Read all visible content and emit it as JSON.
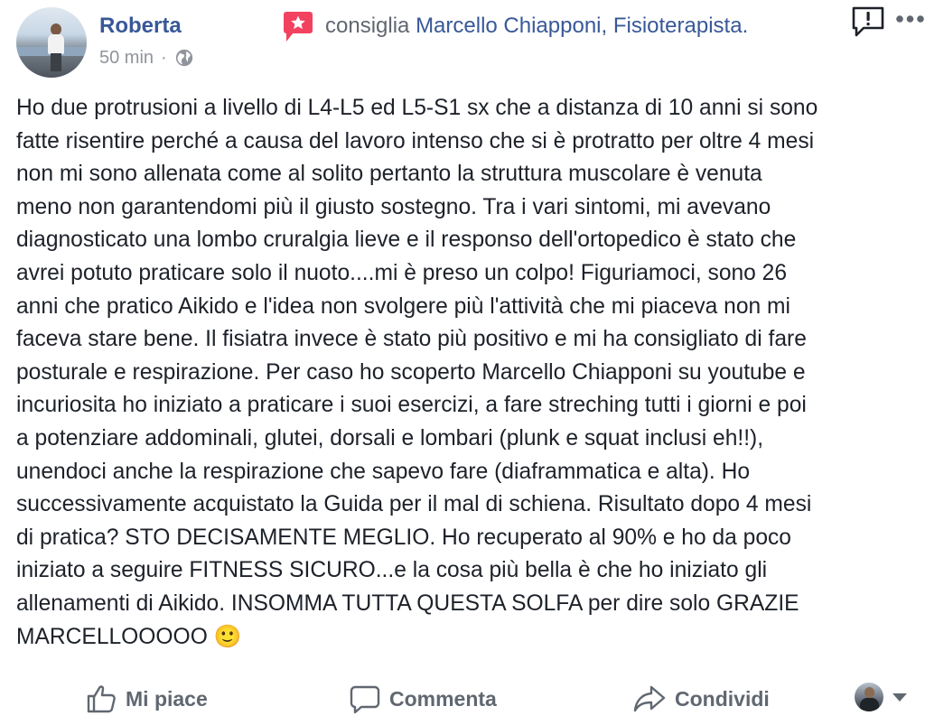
{
  "post": {
    "author": "Roberta",
    "time": "50 min",
    "recommend_verb": "consiglia",
    "recommended_page": "Marcello Chiapponi, Fisioterapista.",
    "body": "Ho due protrusioni a livello di L4-L5 ed L5-S1 sx che a distanza di 10 anni si sono\nfatte risentire perché a causa del lavoro intenso che si è protratto per oltre 4 mesi\nnon mi sono allenata come al solito pertanto la struttura muscolare è venuta\nmeno non garantendomi più il giusto sostegno. Tra i vari sintomi, mi avevano\ndiagnosticato una lombo cruralgia lieve e il responso dell'ortopedico è stato che\navrei potuto praticare solo il nuoto....mi è preso un colpo! Figuriamoci, sono 26\nanni che pratico Aikido e l'idea non svolgere più l'attività che mi piaceva non mi\nfaceva stare bene. Il fisiatra invece è stato più positivo e mi ha consigliato di fare\nposturale e respirazione. Per caso ho scoperto Marcello Chiapponi su youtube e\nincuriosita ho iniziato a praticare i suoi esercizi, a fare streching tutti i giorni e poi\na potenziare addominali, glutei, dorsali e lombari (plunk e squat inclusi eh!!),\nunendoci anche la respirazione che sapevo fare (diaframmatica e alta). Ho\nsuccessivamente acquistato la Guida per il mal di schiena. Risultato dopo 4 mesi\ndi pratica? STO DECISAMENTE MEGLIO. Ho recuperato al 90% e ho da poco\niniziato a seguire FITNESS SICURO...e la cosa più bella è che ho iniziato gli\nallenamenti di Aikido. INSOMMA TUTTA QUESTA SOLFA per dire solo GRAZIE\nMARCELLOOOOO 🙂"
  },
  "actions": {
    "like": "Mi piace",
    "comment": "Commenta",
    "share": "Condividi"
  },
  "icons": {
    "recommend": "recommend-flag-icon",
    "report": "report-icon",
    "more": "more-options-icon",
    "privacy": "globe-icon",
    "like": "thumbs-up-icon",
    "comment": "speech-bubble-icon",
    "share": "share-arrow-icon",
    "dropdown": "chevron-down-icon"
  },
  "colors": {
    "link": "#385898",
    "muted": "#90949c",
    "action": "#606770",
    "recommend_accent": "#f3425f"
  }
}
